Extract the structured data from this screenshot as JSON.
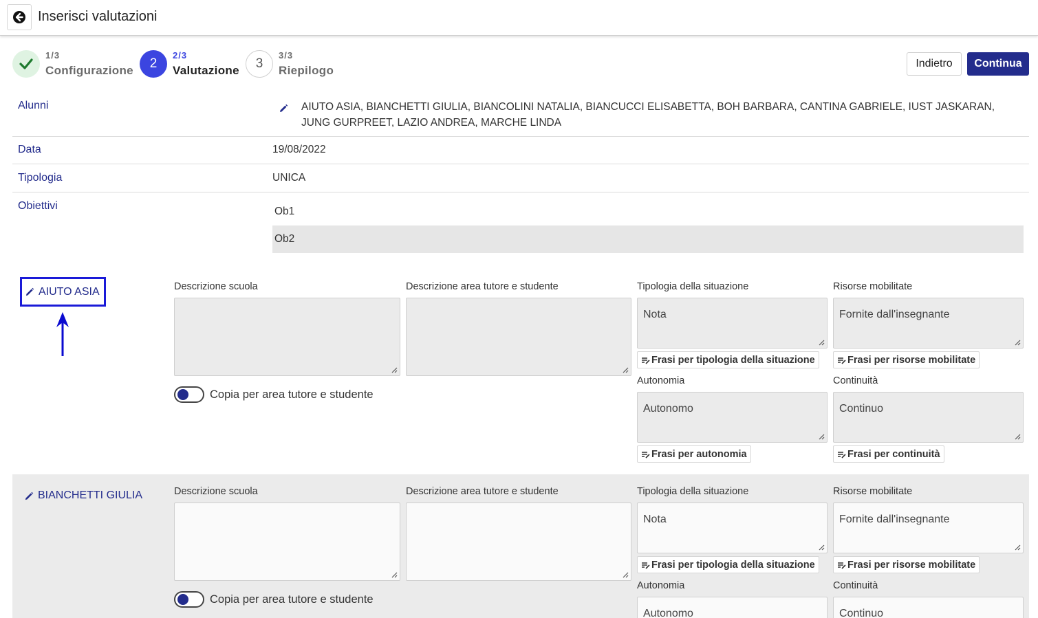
{
  "header": {
    "title": "Inserisci valutazioni",
    "back_icon": "arrow-left-circle-icon"
  },
  "stepper": {
    "steps": [
      {
        "num": "1/3",
        "label": "Configurazione",
        "state": "done",
        "icon": "check-icon"
      },
      {
        "num": "2/3",
        "label": "Valutazione",
        "state": "active",
        "badge": "2"
      },
      {
        "num": "3/3",
        "label": "Riepilogo",
        "state": "pending",
        "badge": "3"
      }
    ],
    "back_label": "Indietro",
    "continue_label": "Continua"
  },
  "info": {
    "alunni_label": "Alunni",
    "alunni_value": "AIUTO ASIA, BIANCHETTI GIULIA, BIANCOLINI NATALIA, BIANCUCCI ELISABETTA, BOH BARBARA, CANTINA GABRIELE, IUST JASKARAN, JUNG GURPREET, LAZIO ANDREA, MARCHE LINDA",
    "data_label": "Data",
    "data_value": "19/08/2022",
    "tipologia_label": "Tipologia",
    "tipologia_value": "UNICA",
    "obiettivi_label": "Obiettivi",
    "obiettivi": [
      "Ob1",
      "Ob2"
    ]
  },
  "labels": {
    "descrizione_scuola": "Descrizione scuola",
    "descrizione_area": "Descrizione area tutore e studente",
    "tipologia_situazione": "Tipologia della situazione",
    "risorse_mobilitate": "Risorse mobilitate",
    "autonomia": "Autonomia",
    "continuita": "Continuità",
    "frasi_tipologia": "Frasi per tipologia della situazione",
    "frasi_risorse": "Frasi per risorse mobilitate",
    "frasi_autonomia": "Frasi per autonomia",
    "frasi_continuita": "Frasi per continuità",
    "copia_toggle": "Copia per area tutore e studente"
  },
  "students": [
    {
      "name": "AIUTO ASIA",
      "tipologia": "Nota",
      "risorse": "Fornite dall'insegnante",
      "autonomia": "Autonomo",
      "continuita": "Continuo",
      "highlighted": true,
      "copia_toggle_on": true
    },
    {
      "name": "BIANCHETTI GIULIA",
      "tipologia": "Nota",
      "risorse": "Fornite dall'insegnante",
      "autonomia": "Autonomo",
      "continuita": "Continuo",
      "highlighted": false,
      "copia_toggle_on": true
    }
  ],
  "colors": {
    "primary": "#232c8c",
    "active_step": "#3b45e0",
    "annotation": "#1a1ad8"
  }
}
